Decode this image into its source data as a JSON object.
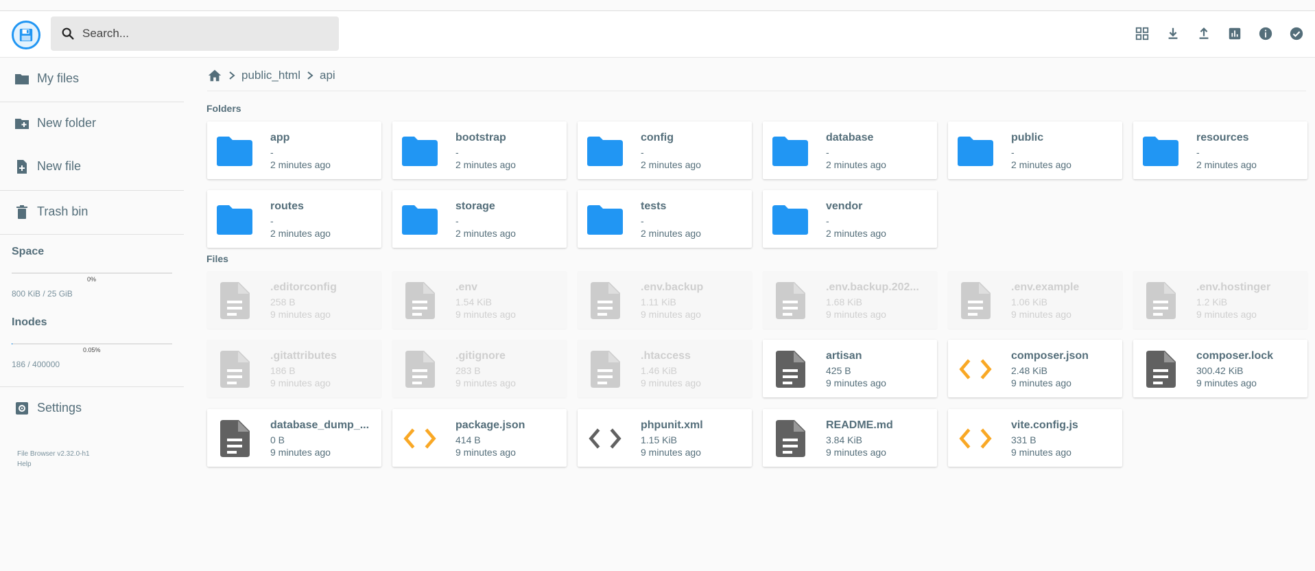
{
  "search": {
    "placeholder": "Search..."
  },
  "sidebar": {
    "my_files": "My files",
    "new_folder": "New folder",
    "new_file": "New file",
    "trash": "Trash bin",
    "space_title": "Space",
    "space_pct": "0%",
    "space_usage": "800 KiB / 25 GiB",
    "space_fraction": 0,
    "inodes_title": "Inodes",
    "inodes_pct": "0.05%",
    "inodes_usage": "186 / 400000",
    "inodes_fraction": 0.0005,
    "settings": "Settings",
    "version": "File Browser v2.32.0-h1",
    "help": "Help"
  },
  "breadcrumb": {
    "items": [
      "public_html",
      "api"
    ]
  },
  "sections": {
    "folders": "Folders",
    "files": "Files"
  },
  "folders": [
    {
      "name": "app",
      "size": "-",
      "modified": "2 minutes ago"
    },
    {
      "name": "bootstrap",
      "size": "-",
      "modified": "2 minutes ago"
    },
    {
      "name": "config",
      "size": "-",
      "modified": "2 minutes ago"
    },
    {
      "name": "database",
      "size": "-",
      "modified": "2 minutes ago"
    },
    {
      "name": "public",
      "size": "-",
      "modified": "2 minutes ago"
    },
    {
      "name": "resources",
      "size": "-",
      "modified": "2 minutes ago"
    },
    {
      "name": "routes",
      "size": "-",
      "modified": "2 minutes ago"
    },
    {
      "name": "storage",
      "size": "-",
      "modified": "2 minutes ago"
    },
    {
      "name": "tests",
      "size": "-",
      "modified": "2 minutes ago"
    },
    {
      "name": "vendor",
      "size": "-",
      "modified": "2 minutes ago"
    }
  ],
  "files": [
    {
      "name": ".editorconfig",
      "size": "258 B",
      "modified": "9 minutes ago",
      "icon": "document-icon",
      "hidden": true
    },
    {
      "name": ".env",
      "size": "1.54 KiB",
      "modified": "9 minutes ago",
      "icon": "document-icon",
      "hidden": true
    },
    {
      "name": ".env.backup",
      "size": "1.11 KiB",
      "modified": "9 minutes ago",
      "icon": "document-icon",
      "hidden": true
    },
    {
      "name": ".env.backup.202...",
      "size": "1.68 KiB",
      "modified": "9 minutes ago",
      "icon": "document-icon",
      "hidden": true
    },
    {
      "name": ".env.example",
      "size": "1.06 KiB",
      "modified": "9 minutes ago",
      "icon": "document-icon",
      "hidden": true
    },
    {
      "name": ".env.hostinger",
      "size": "1.2 KiB",
      "modified": "9 minutes ago",
      "icon": "document-icon",
      "hidden": true
    },
    {
      "name": ".gitattributes",
      "size": "186 B",
      "modified": "9 minutes ago",
      "icon": "document-icon",
      "hidden": true
    },
    {
      "name": ".gitignore",
      "size": "283 B",
      "modified": "9 minutes ago",
      "icon": "document-icon",
      "hidden": true
    },
    {
      "name": ".htaccess",
      "size": "1.46 KiB",
      "modified": "9 minutes ago",
      "icon": "document-icon",
      "hidden": true
    },
    {
      "name": "artisan",
      "size": "425 B",
      "modified": "9 minutes ago",
      "icon": "document-icon",
      "hidden": false
    },
    {
      "name": "composer.json",
      "size": "2.48 KiB",
      "modified": "9 minutes ago",
      "icon": "code-icon",
      "hidden": false,
      "accent": "#f9a825"
    },
    {
      "name": "composer.lock",
      "size": "300.42 KiB",
      "modified": "9 minutes ago",
      "icon": "document-icon",
      "hidden": false
    },
    {
      "name": "database_dump_...",
      "size": "0 B",
      "modified": "9 minutes ago",
      "icon": "document-icon",
      "hidden": false
    },
    {
      "name": "package.json",
      "size": "414 B",
      "modified": "9 minutes ago",
      "icon": "code-icon",
      "hidden": false,
      "accent": "#f9a825"
    },
    {
      "name": "phpunit.xml",
      "size": "1.15 KiB",
      "modified": "9 minutes ago",
      "icon": "code-icon",
      "hidden": false,
      "accent": "#616161"
    },
    {
      "name": "README.md",
      "size": "3.84 KiB",
      "modified": "9 minutes ago",
      "icon": "document-icon",
      "hidden": false
    },
    {
      "name": "vite.config.js",
      "size": "331 B",
      "modified": "9 minutes ago",
      "icon": "code-icon",
      "hidden": false,
      "accent": "#f9a825"
    }
  ],
  "colors": {
    "accent": "#2196f3",
    "folder": "#2196f3",
    "text": "#546e7a",
    "doc": "#616161",
    "doc_dim": "#cccccc"
  }
}
